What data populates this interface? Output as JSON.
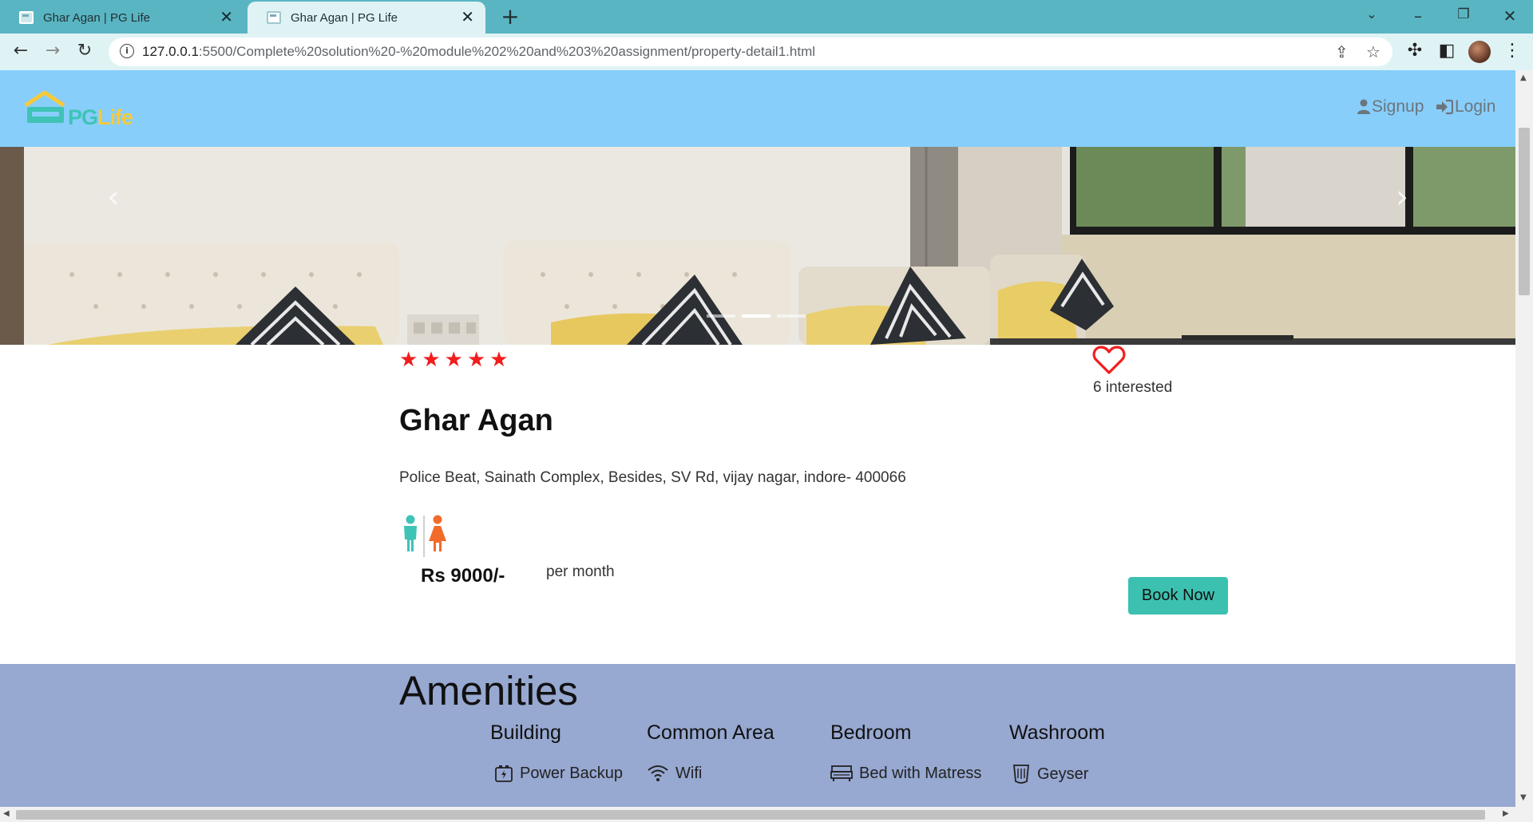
{
  "browser": {
    "tabs": [
      {
        "title": "Ghar Agan | PG Life",
        "active": false
      },
      {
        "title": "Ghar Agan | PG Life",
        "active": true
      }
    ],
    "url_host": "127.0.0.1",
    "url_rest": ":5500/Complete%20solution%20-%20module%202%20and%203%20assignment/property-detail1.html"
  },
  "nav": {
    "logo_pg": "PG",
    "logo_life": "Life",
    "signup_label": "Signup",
    "login_label": "Login"
  },
  "carousel": {
    "slide_count": 3,
    "active_index": 1
  },
  "property": {
    "rating_stars": 5,
    "interested_text": "6 interested",
    "name": "Ghar Agan",
    "address": "Police Beat, Sainath Complex, Besides, SV Rd, vijay nagar, indore- 400066",
    "gender": "unisex",
    "price": "Rs 9000/-",
    "price_period": "per month",
    "book_label": "Book Now"
  },
  "amenities": {
    "title": "Amenities",
    "columns": [
      {
        "heading": "Building",
        "items": [
          {
            "label": "Power Backup",
            "icon": "power-backup-icon"
          }
        ]
      },
      {
        "heading": "Common Area",
        "items": [
          {
            "label": "Wifi",
            "icon": "wifi-icon"
          }
        ]
      },
      {
        "heading": "Bedroom",
        "items": [
          {
            "label": "Bed with Matress",
            "icon": "bed-icon"
          }
        ]
      },
      {
        "heading": "Washroom",
        "items": [
          {
            "label": "Geyser",
            "icon": "geyser-icon"
          }
        ]
      }
    ]
  },
  "colors": {
    "navbar": "#87cefa",
    "accent": "#3cc1b0",
    "stars": "#f21d1d",
    "amenities_bg": "#97a8d1"
  }
}
